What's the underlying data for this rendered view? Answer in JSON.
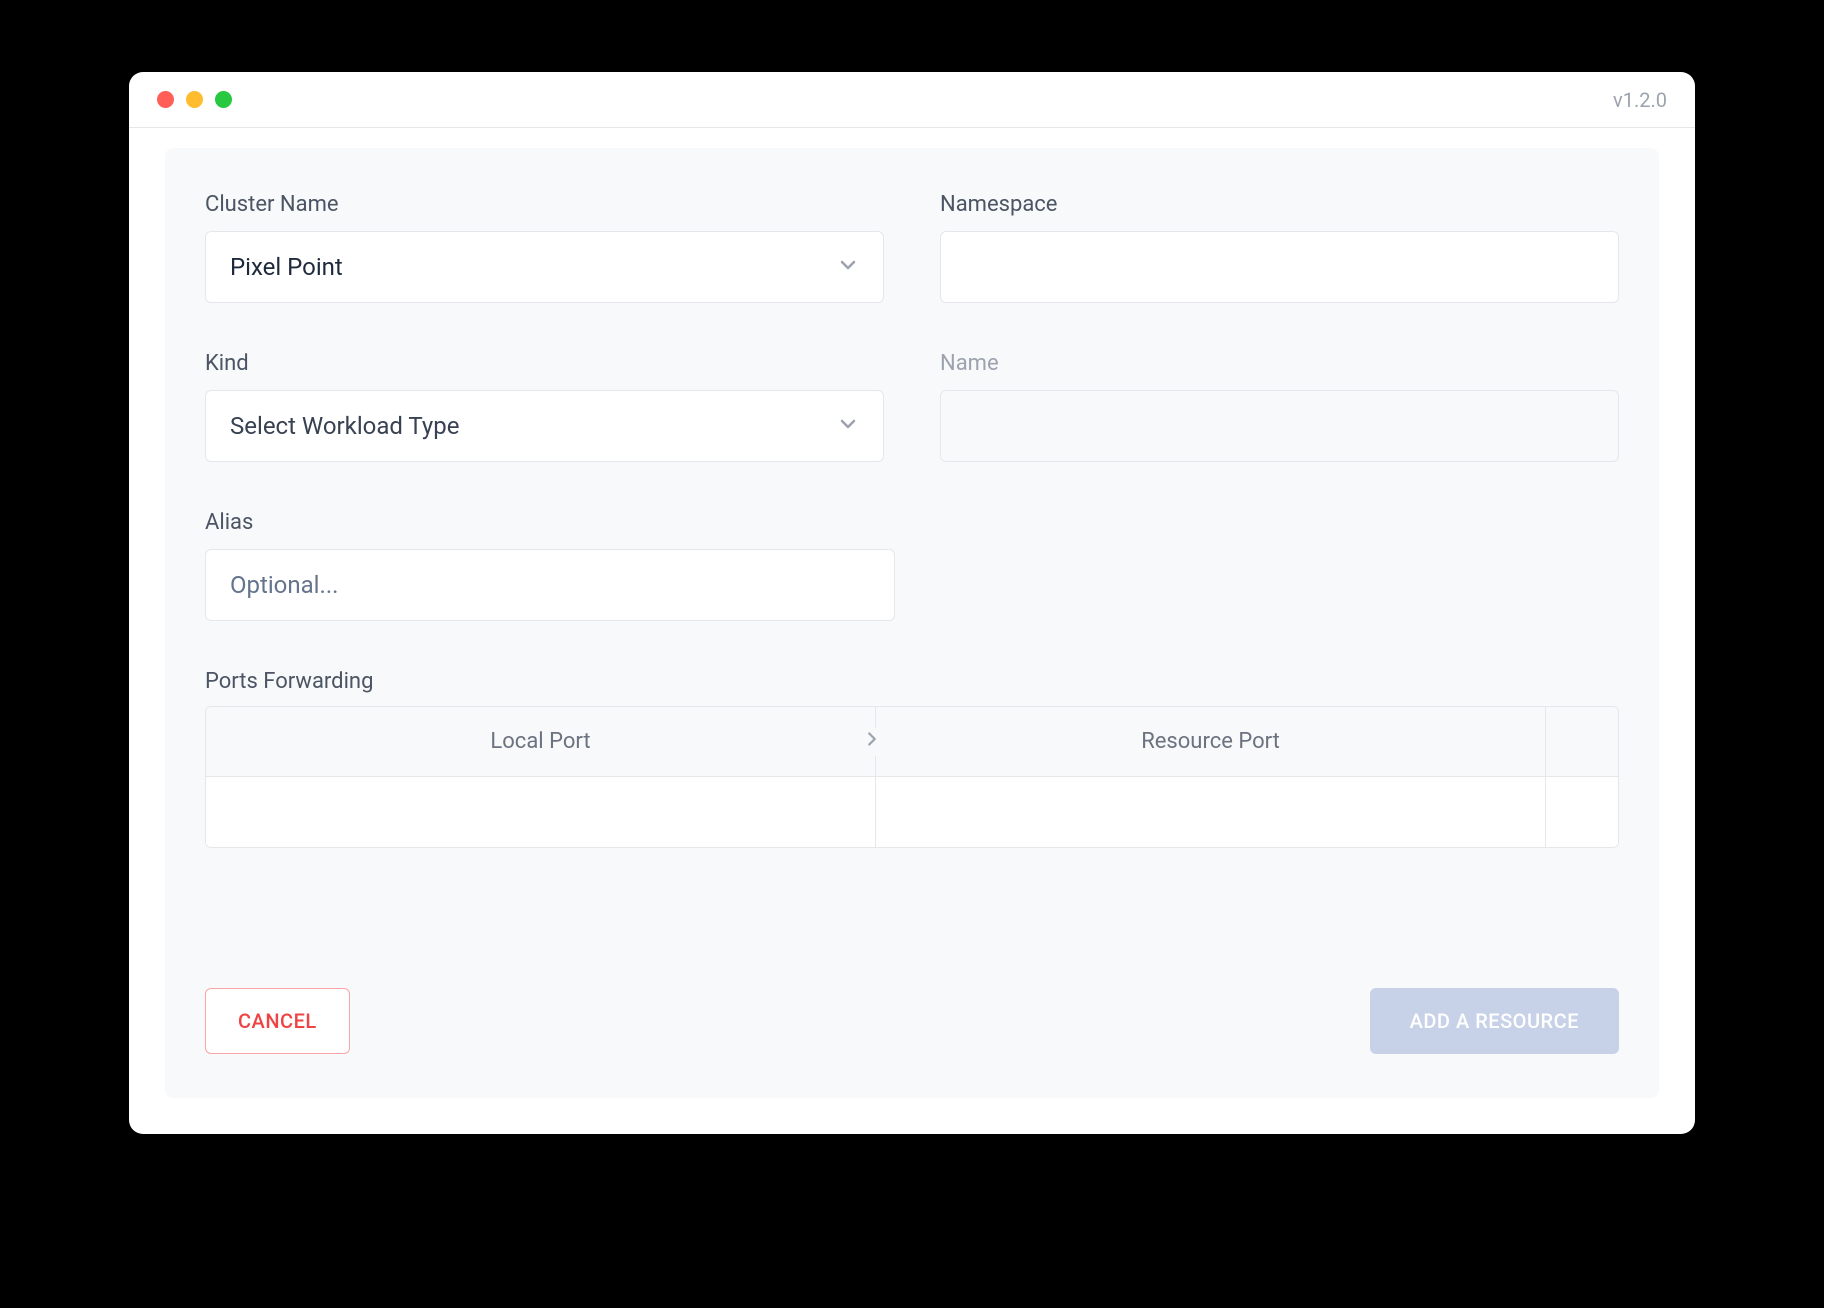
{
  "titlebar": {
    "version": "v1.2.0"
  },
  "form": {
    "cluster_name": {
      "label": "Cluster Name",
      "value": "Pixel Point"
    },
    "namespace": {
      "label": "Namespace",
      "value": ""
    },
    "kind": {
      "label": "Kind",
      "placeholder": "Select Workload Type"
    },
    "name": {
      "label": "Name",
      "value": ""
    },
    "alias": {
      "label": "Alias",
      "placeholder": "Optional..."
    }
  },
  "ports": {
    "section_label": "Ports Forwarding",
    "headers": {
      "local": "Local Port",
      "resource": "Resource Port"
    }
  },
  "actions": {
    "cancel": "CANCEL",
    "submit": "ADD A RESOURCE"
  }
}
